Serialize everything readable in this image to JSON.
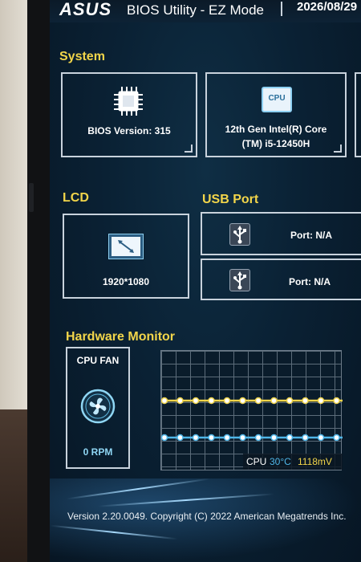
{
  "header": {
    "brand": "ASUS",
    "title": "BIOS Utility - EZ Mode",
    "date": "2026/08/29"
  },
  "system": {
    "title": "System",
    "bios": {
      "label": "BIOS Version: 315",
      "chip_text": ""
    },
    "cpu": {
      "chip_label": "CPU",
      "line1": "12th Gen Intel(R) Core",
      "line2": "(TM) i5-12450H"
    }
  },
  "lcd": {
    "title": "LCD",
    "resolution": "1920*1080"
  },
  "usb": {
    "title": "USB Port",
    "port1": "Port: N/A",
    "port2": "Port: N/A"
  },
  "hardware_monitor": {
    "title": "Hardware Monitor",
    "fan_label": "CPU FAN",
    "fan_rpm": "0 RPM",
    "cpu_label": "CPU",
    "cpu_temp": "30°C",
    "cpu_voltage": "1118mV",
    "temp_color": "#f2d54a",
    "volt_color": "#4fb6e8"
  },
  "footer": {
    "copyright": "Version 2.20.0049. Copyright (C) 2022 American Megatrends Inc."
  }
}
